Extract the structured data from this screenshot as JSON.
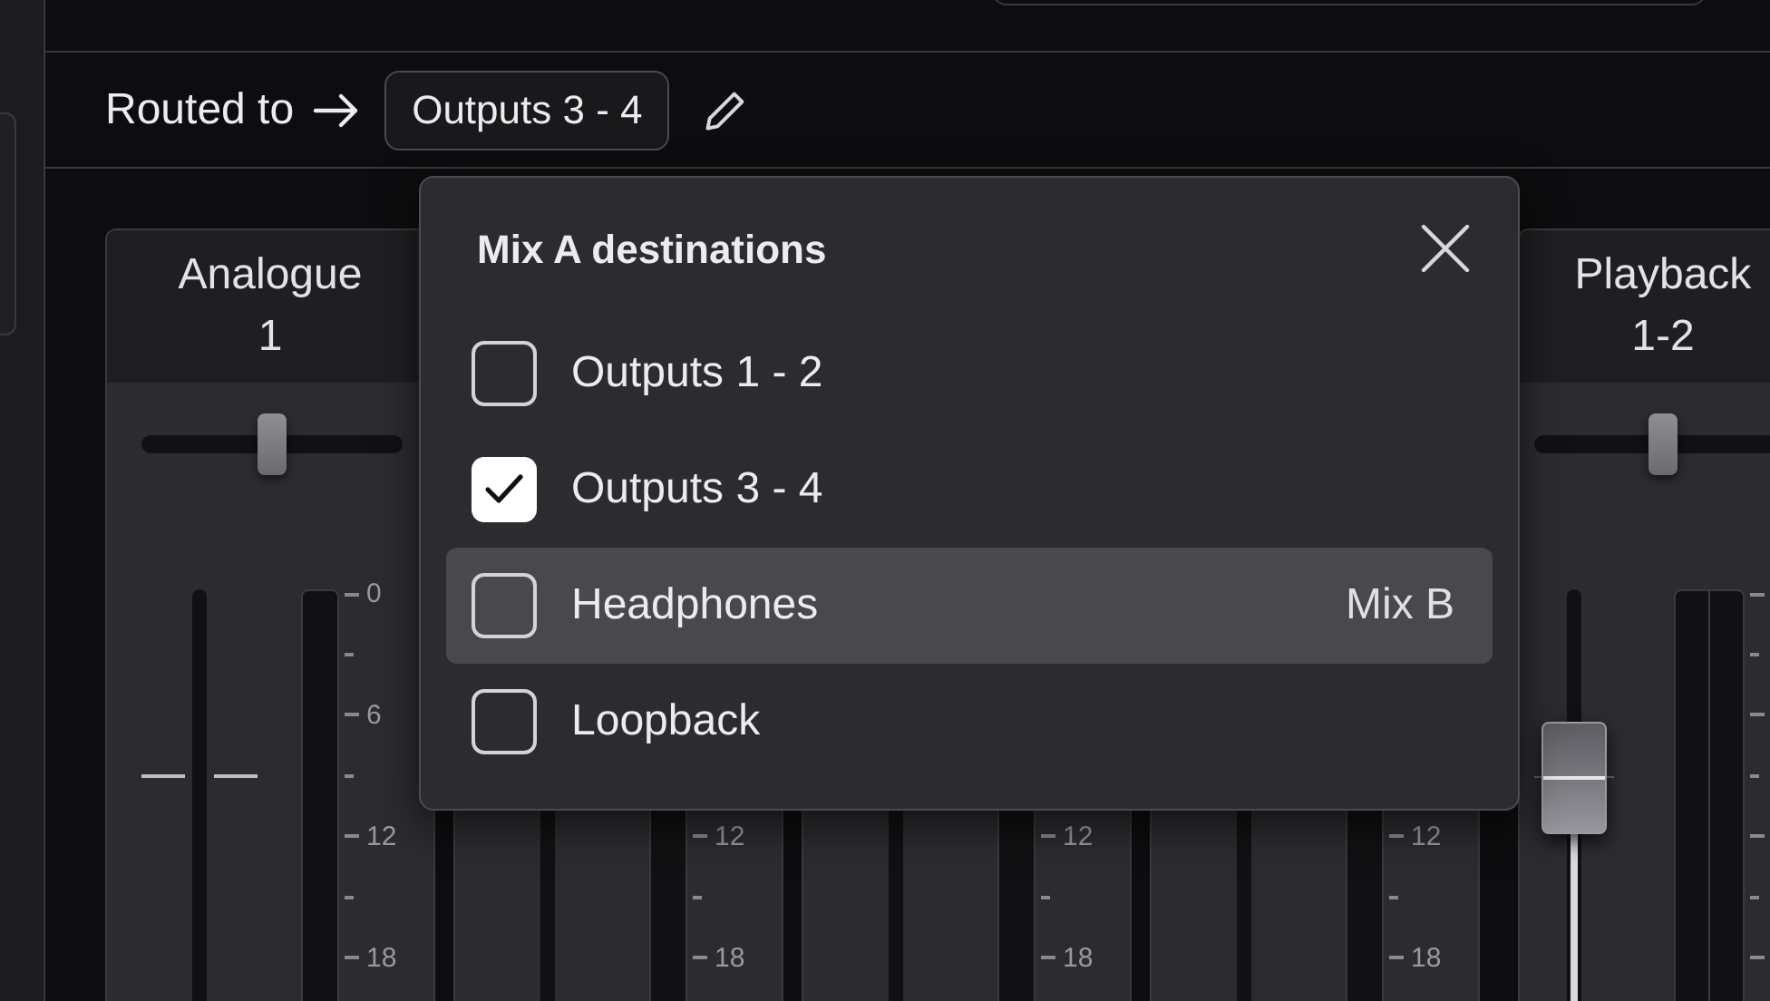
{
  "route_bar": {
    "label": "Routed to",
    "destination": "Outputs 3 - 4"
  },
  "channels": [
    {
      "kind": "mono",
      "title": "Analogue",
      "subtitle": "1",
      "pan": {
        "level": 0.5
      },
      "scale": [
        "0",
        "6",
        "12",
        "18"
      ]
    },
    {
      "kind": "mono",
      "scale": [
        "12",
        "18"
      ]
    },
    {
      "kind": "mono",
      "scale": [
        "12",
        "18"
      ]
    },
    {
      "kind": "mono",
      "scale": [
        "12",
        "18"
      ]
    },
    {
      "kind": "stereo",
      "title": "Playback",
      "subtitle": "1-2",
      "pan": {
        "level": 0.5
      }
    }
  ],
  "popup": {
    "title": "Mix A destinations",
    "items": [
      {
        "label": "Outputs 1 - 2",
        "checked": false,
        "selected": false
      },
      {
        "label": "Outputs 3 - 4",
        "checked": true,
        "selected": false
      },
      {
        "label": "Headphones",
        "checked": false,
        "selected": true,
        "note": "Mix B"
      },
      {
        "label": "Loopback",
        "checked": false,
        "selected": false
      }
    ]
  }
}
